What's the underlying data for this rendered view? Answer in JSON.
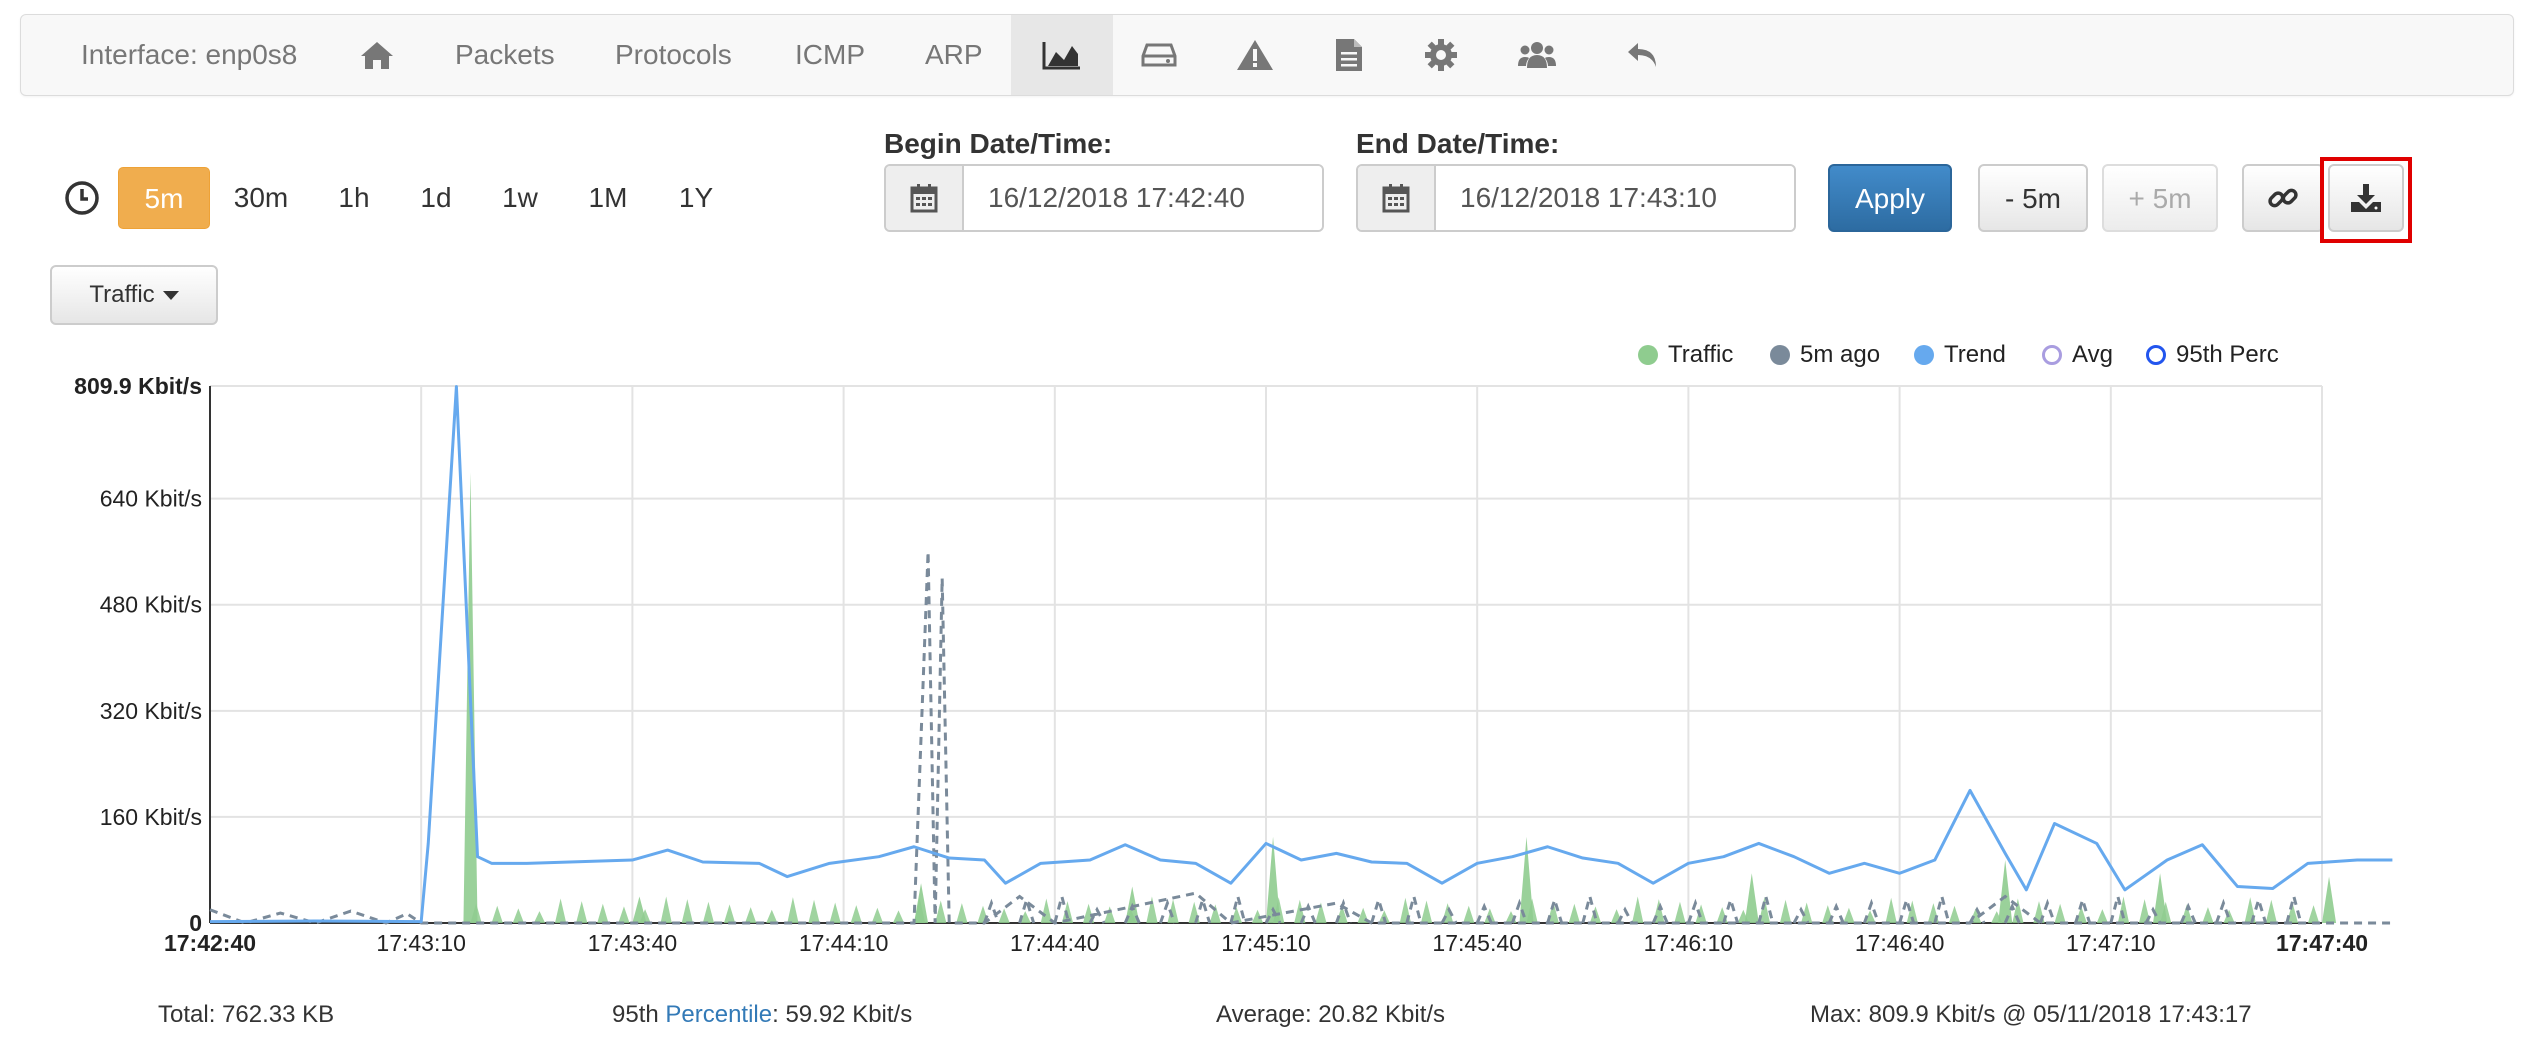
{
  "nav": {
    "interface_label": "Interface: enp0s8",
    "packets": "Packets",
    "protocols": "Protocols",
    "icmp": "ICMP",
    "arp": "ARP",
    "icons": [
      "home-icon",
      "area-chart-icon",
      "hdd-icon",
      "warning-icon",
      "file-icon",
      "gear-icon",
      "users-icon",
      "reply-icon"
    ],
    "active": "area-chart-icon"
  },
  "toolbar": {
    "ranges": [
      "5m",
      "30m",
      "1h",
      "1d",
      "1w",
      "1M",
      "1Y"
    ],
    "active_range": "5m",
    "begin_label": "Begin Date/Time:",
    "begin_value": "16/12/2018 17:42:40",
    "end_label": "End Date/Time:",
    "end_value": "16/12/2018 17:43:10",
    "apply": "Apply",
    "minus": "- 5m",
    "plus": "+ 5m",
    "metric_dropdown": "Traffic",
    "icons": [
      "clock-icon",
      "calendar-icon",
      "link-icon",
      "download-icon"
    ]
  },
  "legend": {
    "traffic": "Traffic",
    "ago": "5m ago",
    "trend": "Trend",
    "avg": "Avg",
    "perc": "95th Perc"
  },
  "colors": {
    "traffic": "#8fcc8f",
    "ago": "#7a8a9a",
    "trend": "#66a9ee",
    "avg": "#a99de0",
    "perc": "#2255ee",
    "accent": "#f0ad4e",
    "primary": "#337ab7"
  },
  "chart_data": {
    "type": "area",
    "y_unit": "Kbit/s",
    "ylim": [
      0,
      809.9
    ],
    "y_ticks": [
      "809.9 Kbit/s",
      "640 Kbit/s",
      "480 Kbit/s",
      "320 Kbit/s",
      "160 Kbit/s",
      "0"
    ],
    "x_ticks": [
      "17:42:40",
      "17:43:10",
      "17:43:40",
      "17:44:10",
      "17:44:40",
      "17:45:10",
      "17:45:40",
      "17:46:10",
      "17:46:40",
      "17:47:10",
      "17:47:40"
    ],
    "grid": true,
    "legend_position": "top-right",
    "series": [
      {
        "name": "Trend",
        "style": "line",
        "points": [
          [
            0,
            2
          ],
          [
            15,
            3
          ],
          [
            30,
            2
          ],
          [
            31,
            120
          ],
          [
            35,
            809
          ],
          [
            38,
            100
          ],
          [
            40,
            90
          ],
          [
            45,
            90
          ],
          [
            60,
            95
          ],
          [
            65,
            110
          ],
          [
            70,
            92
          ],
          [
            78,
            90
          ],
          [
            82,
            70
          ],
          [
            88,
            90
          ],
          [
            95,
            100
          ],
          [
            100,
            115
          ],
          [
            105,
            98
          ],
          [
            110,
            95
          ],
          [
            113,
            60
          ],
          [
            118,
            90
          ],
          [
            125,
            95
          ],
          [
            130,
            118
          ],
          [
            135,
            95
          ],
          [
            140,
            90
          ],
          [
            145,
            60
          ],
          [
            150,
            120
          ],
          [
            155,
            95
          ],
          [
            160,
            105
          ],
          [
            165,
            92
          ],
          [
            170,
            90
          ],
          [
            175,
            60
          ],
          [
            180,
            90
          ],
          [
            185,
            100
          ],
          [
            190,
            115
          ],
          [
            195,
            98
          ],
          [
            200,
            90
          ],
          [
            205,
            60
          ],
          [
            210,
            90
          ],
          [
            215,
            100
          ],
          [
            220,
            120
          ],
          [
            225,
            100
          ],
          [
            230,
            75
          ],
          [
            235,
            90
          ],
          [
            240,
            75
          ],
          [
            245,
            95
          ],
          [
            250,
            200
          ],
          [
            255,
            105
          ],
          [
            258,
            50
          ],
          [
            262,
            150
          ],
          [
            268,
            120
          ],
          [
            272,
            50
          ],
          [
            278,
            95
          ],
          [
            283,
            118
          ],
          [
            288,
            55
          ],
          [
            293,
            52
          ],
          [
            298,
            90
          ],
          [
            305,
            95
          ],
          [
            310,
            95
          ]
        ]
      },
      {
        "name": "Traffic",
        "style": "area",
        "points": [
          [
            36,
            0
          ],
          [
            37,
            680
          ],
          [
            38,
            0
          ],
          [
            60,
            0
          ],
          [
            61,
            40
          ],
          [
            62,
            0
          ],
          [
            100,
            0
          ],
          [
            101,
            60
          ],
          [
            102,
            0
          ],
          [
            130,
            0
          ],
          [
            131,
            55
          ],
          [
            132,
            0
          ],
          [
            150,
            0
          ],
          [
            151,
            130
          ],
          [
            152,
            0
          ],
          [
            186,
            0
          ],
          [
            187,
            130
          ],
          [
            188,
            0
          ],
          [
            218,
            0
          ],
          [
            219,
            75
          ],
          [
            220,
            0
          ],
          [
            254,
            0
          ],
          [
            255,
            95
          ],
          [
            256,
            0
          ],
          [
            276,
            0
          ],
          [
            277,
            75
          ],
          [
            278,
            0
          ],
          [
            300,
            0
          ],
          [
            301,
            70
          ],
          [
            302,
            0
          ]
        ]
      },
      {
        "name": "5m ago",
        "style": "dashed",
        "points": [
          [
            0,
            20
          ],
          [
            5,
            0
          ],
          [
            10,
            15
          ],
          [
            15,
            0
          ],
          [
            20,
            18
          ],
          [
            25,
            0
          ],
          [
            28,
            14
          ],
          [
            30,
            0
          ],
          [
            100,
            0
          ],
          [
            102,
            560
          ],
          [
            103,
            0
          ],
          [
            104,
            520
          ],
          [
            105,
            0
          ],
          [
            110,
            0
          ],
          [
            115,
            40
          ],
          [
            120,
            0
          ],
          [
            140,
            45
          ],
          [
            145,
            0
          ],
          [
            160,
            30
          ],
          [
            165,
            0
          ],
          [
            250,
            0
          ],
          [
            255,
            40
          ],
          [
            260,
            0
          ],
          [
            310,
            0
          ]
        ]
      }
    ]
  },
  "stats": {
    "total": "Total: 762.33 KB",
    "perc_prefix": "95th ",
    "perc_link": "Percentile",
    "perc_suffix": ": 59.92 Kbit/s",
    "average": "Average: 20.82 Kbit/s",
    "max": "Max: 809.9 Kbit/s @ 05/11/2018 17:43:17"
  }
}
